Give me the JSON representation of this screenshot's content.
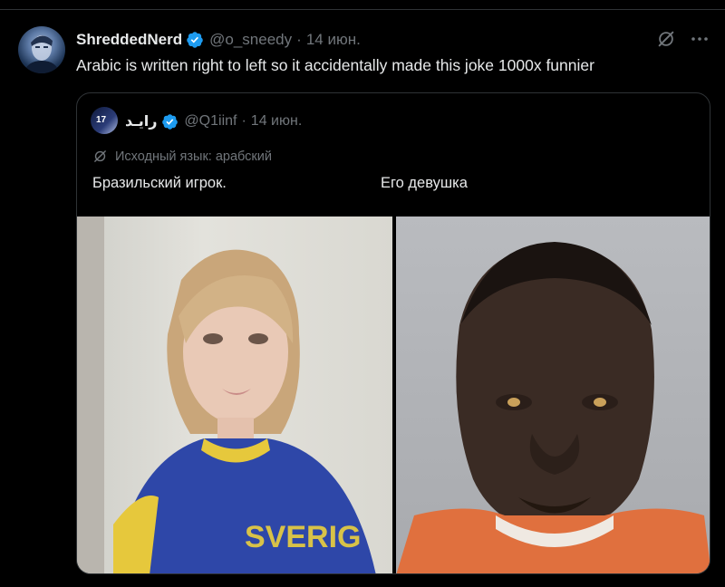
{
  "tweet": {
    "author_name": "ShreddedNerd",
    "handle": "@o_sneedy",
    "separator": "·",
    "date": "14 июн.",
    "text": "Arabic is written right to left so it accidentally made this joke 1000x funnier",
    "icons": {
      "verified": "verified-badge-icon",
      "grok": "grok-icon",
      "more": "more-icon"
    }
  },
  "quote": {
    "author_name": "رايـد",
    "avatar_number": "17",
    "handle": "@Q1iinf",
    "separator": "·",
    "date": "14 июн.",
    "translation_note": "Исходный язык: арабский",
    "text_left": "Бразильский игрок.",
    "text_right": "Его девушка",
    "media": [
      "photo-young-woman-sverige-shirt",
      "photo-man-orange-shirt-mugshot"
    ]
  },
  "colors": {
    "background": "#000000",
    "text": "#e7e9ea",
    "muted": "#71767b",
    "border": "#2f3336",
    "verified": "#1d9bf0"
  }
}
